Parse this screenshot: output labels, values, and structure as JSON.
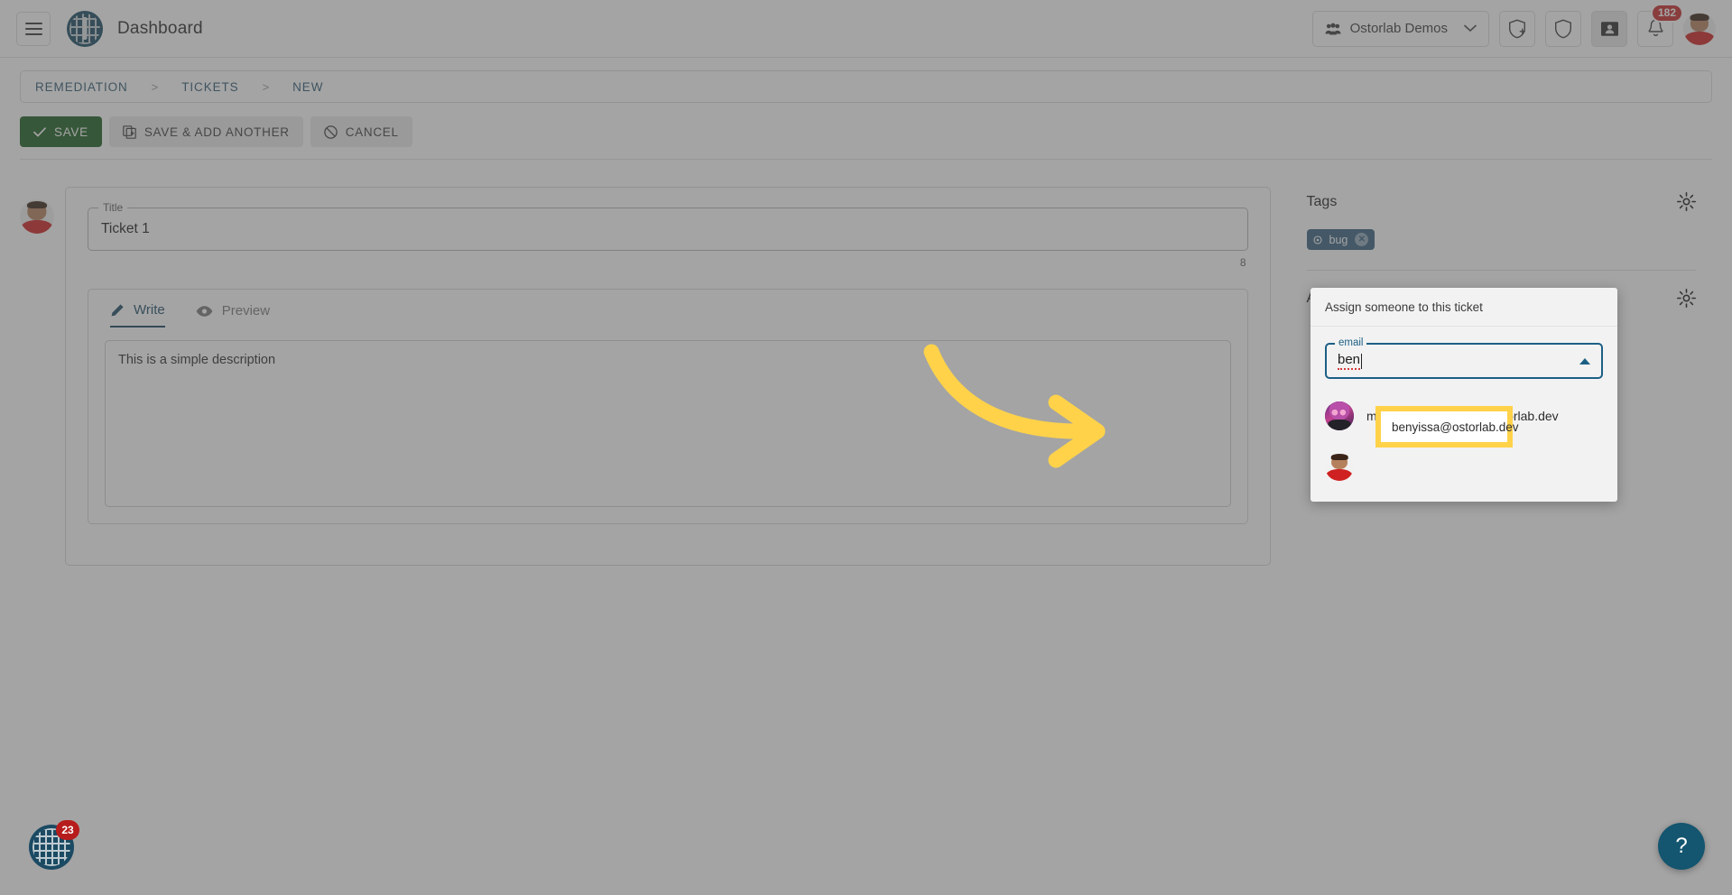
{
  "header": {
    "menu_icon": "hamburger-icon",
    "logo_icon": "ostorlab-logo-icon",
    "title": "Dashboard",
    "org_switcher": {
      "label": "Ostorlab Demos",
      "group_icon": "people-group-icon",
      "chevron_icon": "chevron-down-icon"
    },
    "actions": [
      {
        "name": "scan-add-icon",
        "glyph": "shield-plus-icon"
      },
      {
        "name": "shield-icon",
        "glyph": "shield-icon"
      },
      {
        "name": "ticket-icon",
        "glyph": "ticket-icon"
      },
      {
        "name": "notifications-icon",
        "glyph": "bell-icon",
        "badge": "182"
      }
    ],
    "user_avatar": "user-avatar"
  },
  "breadcrumb": {
    "items": [
      "REMEDIATION",
      "TICKETS",
      "NEW"
    ],
    "separator": ">"
  },
  "toolbar": {
    "save_label": "SAVE",
    "save_icon": "check-icon",
    "save_add_another_label": "SAVE & ADD ANOTHER",
    "save_add_another_icon": "copy-add-icon",
    "cancel_label": "CANCEL",
    "cancel_icon": "block-icon",
    "save_color": "#1b5e20"
  },
  "form": {
    "title_field": {
      "legend": "Title",
      "value": "Ticket 1",
      "char_count": "8"
    },
    "editor": {
      "tabs": [
        {
          "label": "Write",
          "icon": "pencil-icon",
          "active": true
        },
        {
          "label": "Preview",
          "icon": "eye-icon",
          "active": false
        }
      ],
      "description": "This is a simple description"
    }
  },
  "sidebar": {
    "tags": {
      "title": "Tags",
      "settings_icon": "gear-icon",
      "chips": [
        {
          "label": "bug",
          "lead_icon": "tag-icon",
          "remove_icon": "close-icon",
          "color": "#37617f"
        }
      ]
    },
    "assignee": {
      "title": "Assignee",
      "settings_icon": "gear-icon"
    }
  },
  "assign_popup": {
    "heading": "Assign someone to this ticket",
    "input": {
      "legend": "email",
      "value": "ben",
      "collapse_icon": "chevron-up-icon",
      "accent": "#1c5f85"
    },
    "options": [
      {
        "email": "mohamed.benchikh@ostorlab.dev",
        "avatar": "avatar-purple",
        "highlighted": false
      },
      {
        "email": "benyissa@ostorlab.dev",
        "avatar": "avatar-red",
        "highlighted": true
      }
    ]
  },
  "annotation": {
    "arrow_icon": "curved-arrow-icon",
    "arrow_color": "#FFD24A",
    "highlight_color": "#FFD24A"
  },
  "floating": {
    "logo_badge": "23",
    "logo_icon": "ostorlab-logo-icon",
    "help_label": "?",
    "help_icon": "help-icon",
    "help_color": "#14556f"
  }
}
